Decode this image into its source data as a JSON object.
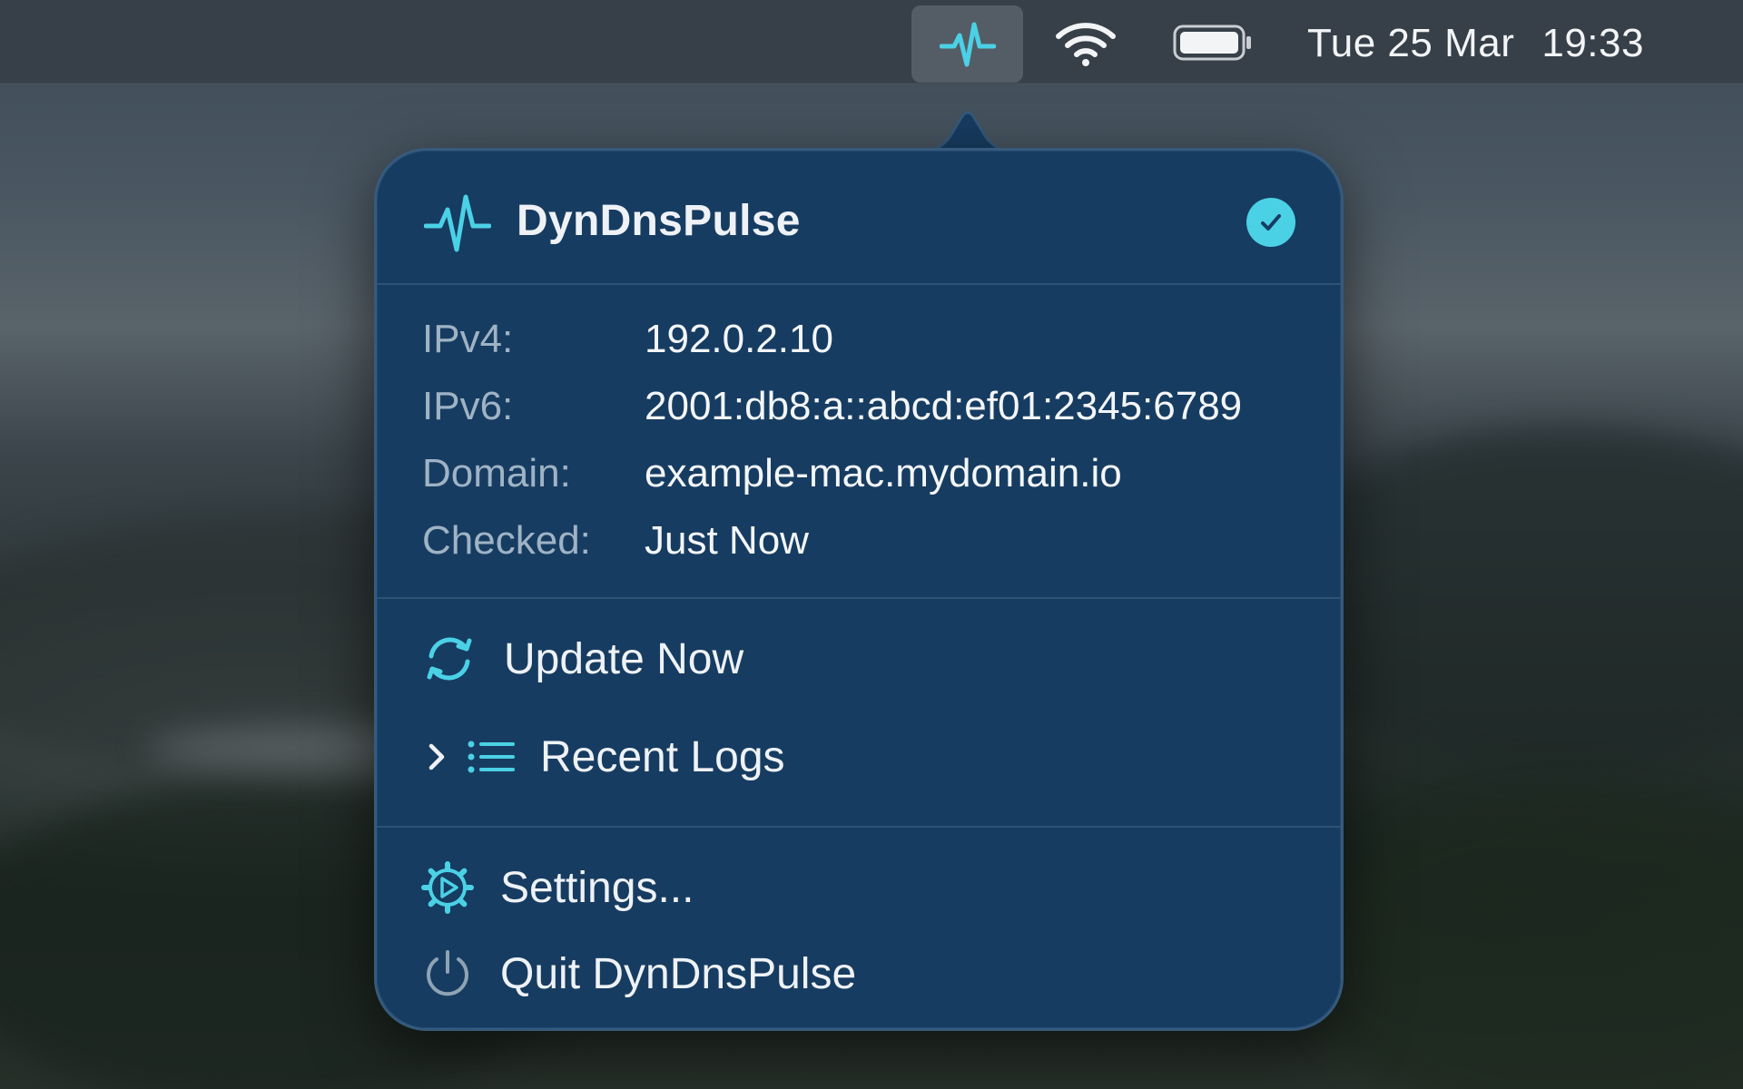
{
  "menubar": {
    "app_icon": "pulse-icon",
    "wifi_icon": "wifi-icon",
    "battery_icon": "battery-icon",
    "date": "Tue 25 Mar",
    "time": "19:33"
  },
  "popover": {
    "app_name": "DynDnsPulse",
    "status_icon": "checkmark-circle-icon",
    "accent_color": "#4bd1e6",
    "info": [
      {
        "label": "IPv4:",
        "value": "192.0.2.10"
      },
      {
        "label": "IPv6:",
        "value": "2001:db8:a::abcd:ef01:2345:6789"
      },
      {
        "label": "Domain:",
        "value": "example-mac.mydomain.io"
      },
      {
        "label": "Checked:",
        "value": "Just Now"
      }
    ],
    "actions": {
      "update_now": "Update Now",
      "recent_logs": "Recent Logs",
      "settings": "Settings...",
      "quit": "Quit DynDnsPulse"
    }
  }
}
